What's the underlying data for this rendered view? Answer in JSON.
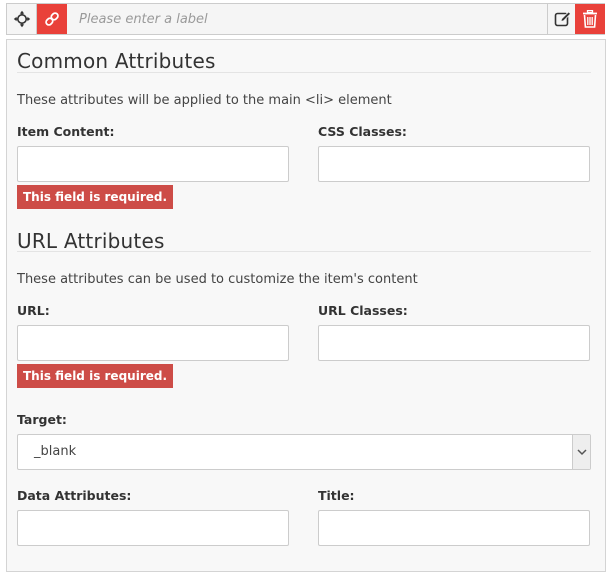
{
  "toolbar": {
    "label_placeholder": "Please enter a label",
    "icons": {
      "move": "move-icon",
      "link": "link-icon",
      "edit": "edit-icon",
      "delete": "trash-icon"
    }
  },
  "common": {
    "title": "Common Attributes",
    "description": "These attributes will be applied to the main <li> element",
    "item_content_label": "Item Content:",
    "item_content_value": "",
    "item_content_error": "This field is required.",
    "css_classes_label": "CSS Classes:",
    "css_classes_value": ""
  },
  "url": {
    "title": "URL Attributes",
    "description": "These attributes can be used to customize the item's content",
    "url_label": "URL:",
    "url_value": "",
    "url_error": "This field is required.",
    "url_classes_label": "URL Classes:",
    "url_classes_value": "",
    "target_label": "Target:",
    "target_value": "_blank",
    "data_attributes_label": "Data Attributes:",
    "data_attributes_value": "",
    "title_label": "Title:",
    "title_value": ""
  },
  "colors": {
    "accent_red": "#e9413a",
    "error_red": "#cd4c47",
    "panel_bg": "#f8f8f8",
    "border": "#cccccc"
  }
}
